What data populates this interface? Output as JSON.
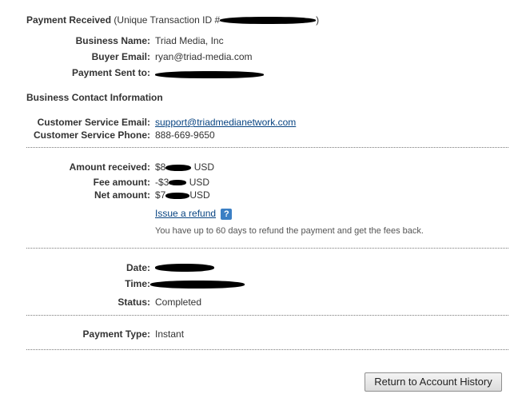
{
  "header": {
    "title": "Payment Received",
    "transaction_prefix": "(Unique Transaction ID #",
    "transaction_suffix": ")"
  },
  "details": {
    "business_name_label": "Business Name:",
    "business_name_value": "Triad Media, Inc",
    "buyer_email_label": "Buyer Email:",
    "buyer_email_value": "ryan@triad-media.com",
    "payment_sent_label": "Payment Sent to:"
  },
  "contact": {
    "heading": "Business Contact Information",
    "email_label": "Customer Service Email:",
    "email_value": "support@triadmedianetwork.com",
    "phone_label": "Customer Service Phone:",
    "phone_value": "888-669-9650"
  },
  "amounts": {
    "received_label": "Amount received:",
    "received_prefix": "$8",
    "received_currency": "USD",
    "fee_label": "Fee amount:",
    "fee_prefix": "-$3",
    "fee_currency": "USD",
    "net_label": "Net amount:",
    "net_prefix": "$7",
    "net_currency": "USD",
    "refund_link": "Issue a refund",
    "refund_help_icon": "?",
    "refund_note": "You have up to 60 days to refund the payment and get the fees back."
  },
  "timing": {
    "date_label": "Date:",
    "time_label": "Time:",
    "status_label": "Status:",
    "status_value": "Completed"
  },
  "payment_type": {
    "label": "Payment Type:",
    "value": "Instant"
  },
  "footer": {
    "return_button": "Return to Account History"
  },
  "colors": {
    "link": "#084482",
    "help_icon": "#3b7fc4",
    "text": "#333333"
  }
}
